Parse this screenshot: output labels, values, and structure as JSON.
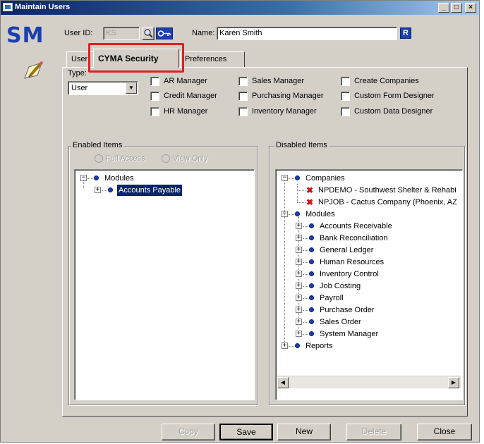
{
  "window": {
    "title": "Maintain Users",
    "controls": [
      "_",
      "□",
      "×"
    ]
  },
  "logo": "SM",
  "header": {
    "user_id_label": "User ID:",
    "user_id_value": "KS",
    "name_label": "Name:",
    "name_value": "Karen Smith",
    "r_badge": "R"
  },
  "tabs": [
    {
      "label": "User"
    },
    {
      "label": "CYMA Security"
    },
    {
      "label": "Preferences"
    }
  ],
  "type": {
    "label": "Type:",
    "selected": "User"
  },
  "checkboxes": [
    {
      "label": "AR Manager",
      "checked": false
    },
    {
      "label": "Credit Manager",
      "checked": false
    },
    {
      "label": "HR Manager",
      "checked": false
    },
    {
      "label": "Sales Manager",
      "checked": false
    },
    {
      "label": "Purchasing Manager",
      "checked": false
    },
    {
      "label": "Inventory Manager",
      "checked": false
    },
    {
      "label": "Create Companies",
      "checked": false
    },
    {
      "label": "Custom Form Designer",
      "checked": false
    },
    {
      "label": "Custom Data Designer",
      "checked": false
    }
  ],
  "enabled": {
    "title": "Enabled Items",
    "radio_full": "Full Access",
    "radio_view": "View Only",
    "tree": [
      {
        "label": "Modules",
        "expander": "⊟"
      },
      {
        "label": "Accounts Payable",
        "expander": "⊞",
        "selected": true
      }
    ]
  },
  "disabled": {
    "title": "Disabled Items",
    "tree": [
      {
        "label": "Companies",
        "expander": "⊟"
      },
      {
        "label": "NPDEMO - Southwest Shelter & Rehabi"
      },
      {
        "label": "NPJOB - Cactus Company (Phoenix, AZ"
      },
      {
        "label": "Modules",
        "expander": "⊟"
      },
      {
        "label": "Accounts Receivable",
        "expander": "⊞"
      },
      {
        "label": "Bank Reconciliation",
        "expander": "⊞"
      },
      {
        "label": "General Ledger",
        "expander": "⊞"
      },
      {
        "label": "Human Resources",
        "expander": "⊞"
      },
      {
        "label": "Inventory Control",
        "expander": "⊞"
      },
      {
        "label": "Job Costing",
        "expander": "⊞"
      },
      {
        "label": "Payroll",
        "expander": "⊞"
      },
      {
        "label": "Purchase Order",
        "expander": "⊞"
      },
      {
        "label": "Sales Order",
        "expander": "⊞"
      },
      {
        "label": "System Manager",
        "expander": "⊞"
      },
      {
        "label": "Reports",
        "expander": "⊞"
      }
    ]
  },
  "buttons": {
    "copy": "Copy",
    "save": "Save",
    "new": "New",
    "delete": "Delete",
    "close": "Close"
  },
  "colors": {
    "highlight": "#e02020",
    "selection": "#0a246a",
    "logo": "#1a3fb0"
  }
}
